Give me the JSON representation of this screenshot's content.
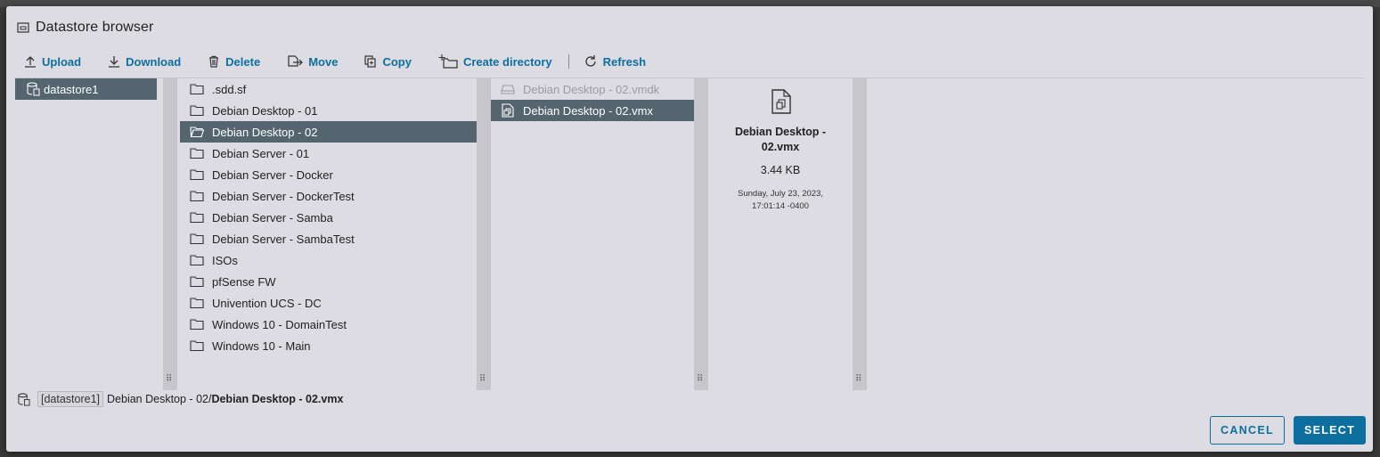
{
  "dialog": {
    "title": "Datastore browser"
  },
  "toolbar": {
    "upload": "Upload",
    "download": "Download",
    "delete": "Delete",
    "move": "Move",
    "copy": "Copy",
    "create_directory": "Create directory",
    "refresh": "Refresh"
  },
  "datastores": [
    {
      "label": "datastore1",
      "selected": true
    }
  ],
  "folders": [
    {
      "label": ".sdd.sf"
    },
    {
      "label": "Debian Desktop - 01"
    },
    {
      "label": "Debian Desktop - 02",
      "selected": true
    },
    {
      "label": "Debian Server - 01"
    },
    {
      "label": "Debian Server - Docker"
    },
    {
      "label": "Debian Server - DockerTest"
    },
    {
      "label": "Debian Server - Samba"
    },
    {
      "label": "Debian Server - SambaTest"
    },
    {
      "label": "ISOs"
    },
    {
      "label": "pfSense FW"
    },
    {
      "label": "Univention UCS - DC"
    },
    {
      "label": "Windows 10 - DomainTest"
    },
    {
      "label": "Windows 10 - Main"
    }
  ],
  "files": [
    {
      "label": "Debian Desktop - 02.vmdk",
      "disabled": true
    },
    {
      "label": "Debian Desktop - 02.vmx",
      "selected": true
    }
  ],
  "detail": {
    "name": "Debian Desktop - 02.vmx",
    "size": "3.44 KB",
    "date": "Sunday, July 23, 2023, 17:01:14 -0400"
  },
  "path": {
    "datastore": "[datastore1]",
    "folder": "Debian Desktop - 02/",
    "file": "Debian Desktop - 02.vmx"
  },
  "buttons": {
    "cancel": "CANCEL",
    "select": "SELECT"
  },
  "colors": {
    "accent": "#0d6fa0",
    "selection": "#55656f",
    "dialog_bg": "#dcdce2"
  }
}
